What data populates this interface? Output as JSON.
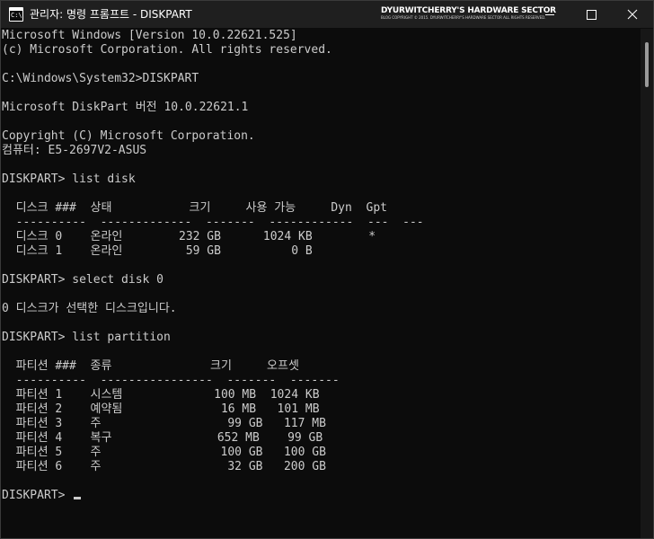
{
  "window": {
    "title": "관리자: 명령 프롬프트 - DISKPART",
    "icon": "cmd-icon",
    "icon_text": "C:\\",
    "controls": {
      "minimize": "minimize-icon",
      "maximize": "maximize-icon",
      "close": "close-icon"
    }
  },
  "watermark": {
    "title": "DYURWITCHERRY'S HARDWARE SECTOR",
    "subtitle": "BLOG COPYRIGHT © 2015. DYURWITCHERRY'S HARDWARE SECTOR ALL RIGHTS RESERVED."
  },
  "console": {
    "lines": [
      "Microsoft Windows [Version 10.0.22621.525]",
      "(c) Microsoft Corporation. All rights reserved.",
      "",
      "C:\\Windows\\System32>DISKPART",
      "",
      "Microsoft DiskPart 버전 10.0.22621.1",
      "",
      "Copyright (C) Microsoft Corporation.",
      "컴퓨터: E5-2697V2-ASUS",
      "",
      "DISKPART> list disk",
      "",
      "  디스크 ###  상태           크기     사용 가능     Dyn  Gpt",
      "  ----------  -------------  -------  ------------  ---  ---",
      "  디스크 0    온라인        232 GB      1024 KB        *",
      "  디스크 1    온라인         59 GB          0 B",
      "",
      "DISKPART> select disk 0",
      "",
      "0 디스크가 선택한 디스크입니다.",
      "",
      "DISKPART> list partition",
      "",
      "  파티션 ###  종류              크기     오프셋",
      "  ----------  ----------------  -------  -------",
      "  파티션 1    시스템             100 MB  1024 KB",
      "  파티션 2    예약됨              16 MB   101 MB",
      "  파티션 3    주                  99 GB   117 MB",
      "  파티션 4    복구               652 MB    99 GB",
      "  파티션 5    주                 100 GB   100 GB",
      "  파티션 6    주                  32 GB   200 GB",
      ""
    ],
    "prompt": "DISKPART> "
  },
  "colors": {
    "background": "#0c0c0c",
    "text": "#cccccc",
    "titlebar": "#1f1f1f"
  }
}
